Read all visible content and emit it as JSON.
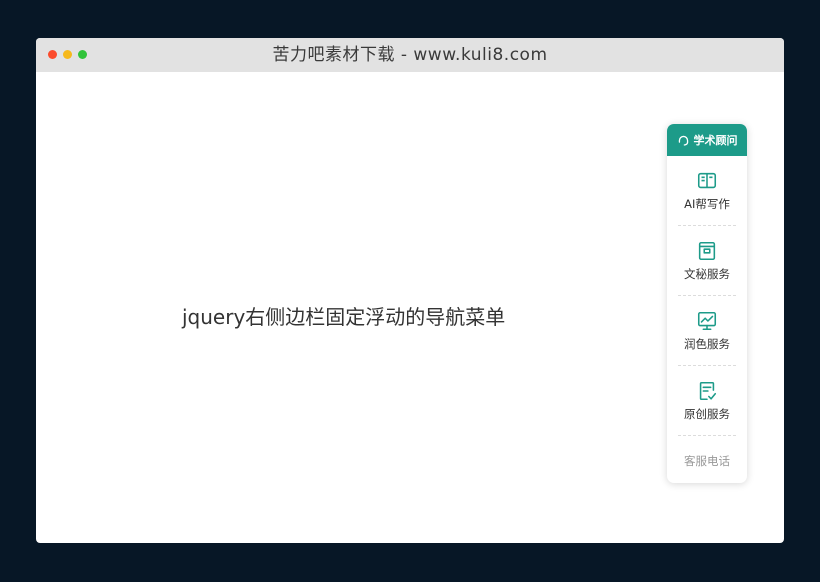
{
  "window": {
    "title": "苦力吧素材下载 - www.kuli8.com"
  },
  "main": {
    "heading": "jquery右侧边栏固定浮动的导航菜单"
  },
  "sidebar": {
    "accent": "#1d9b89",
    "header": {
      "label": "学术顾问",
      "icon": "headset-icon"
    },
    "items": [
      {
        "label": "AI帮写作",
        "icon": "book-icon"
      },
      {
        "label": "文秘服务",
        "icon": "archive-box-icon"
      },
      {
        "label": "润色服务",
        "icon": "monitor-trend-icon"
      },
      {
        "label": "原创服务",
        "icon": "document-check-icon"
      }
    ],
    "footer": {
      "label": "客服电话"
    }
  }
}
